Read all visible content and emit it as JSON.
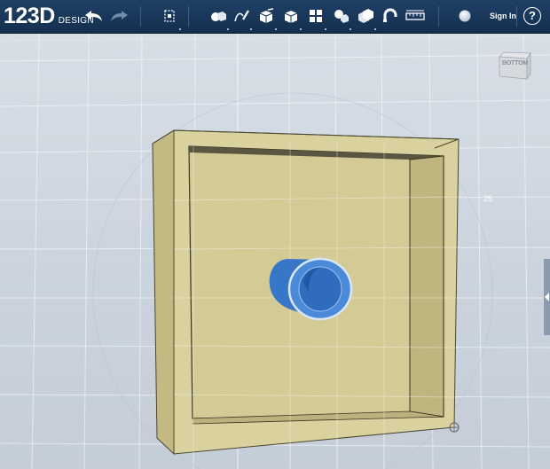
{
  "app": {
    "logo_main": "123D",
    "logo_sub": "DESIGN"
  },
  "toolbar": {
    "undo_icon": "undo-arrow-icon",
    "redo_icon": "redo-arrow-icon",
    "tools": [
      "transform-icon",
      "primitives-icon",
      "sketch-icon",
      "construct-icon",
      "modify-icon",
      "pattern-icon",
      "grouping-icon",
      "combine-icon",
      "snap-icon",
      "measure-icon",
      "material-icon"
    ],
    "signin_label": "Sign In",
    "help_label": "?"
  },
  "viewport": {
    "viewcube_label": "BOTTOM",
    "dimension_label": "25"
  },
  "colors": {
    "toolbar_bg": "#1a3658",
    "box_face": "#d8cf9b",
    "box_side": "#c4bb85",
    "cylinder": "#3a7fd0",
    "grid": "#ffffff"
  }
}
